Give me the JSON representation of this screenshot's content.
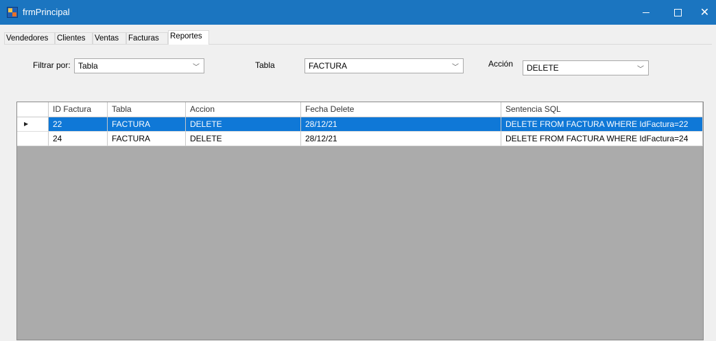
{
  "window": {
    "title": "frmPrincipal",
    "minimize_icon": "minimize-icon",
    "maximize_icon": "maximize-icon",
    "close_icon": "close-icon",
    "title_color": "#1b75c0"
  },
  "tabs": [
    {
      "label": "Vendedores",
      "active": false
    },
    {
      "label": "Clientes",
      "active": false
    },
    {
      "label": "Ventas",
      "active": false
    },
    {
      "label": "Facturas",
      "active": false
    },
    {
      "label": "Reportes",
      "active": true
    }
  ],
  "filters": {
    "filtrar_label": "Filtrar por:",
    "filtrar_value": "Tabla",
    "tabla_label": "Tabla",
    "tabla_value": "FACTURA",
    "accion_label": "Acción",
    "accion_value": "DELETE"
  },
  "grid": {
    "columns": [
      "ID Factura",
      "Tabla",
      "Accion",
      "Fecha Delete",
      "Sentencia SQL"
    ],
    "rows": [
      [
        "22",
        "FACTURA",
        "DELETE",
        "28/12/21",
        "DELETE FROM FACTURA WHERE IdFactura=22"
      ],
      [
        "24",
        "FACTURA",
        "DELETE",
        "28/12/21",
        "DELETE FROM FACTURA WHERE IdFactura=24"
      ]
    ],
    "selected_row": 0,
    "selection_color": "#0f78d7"
  }
}
